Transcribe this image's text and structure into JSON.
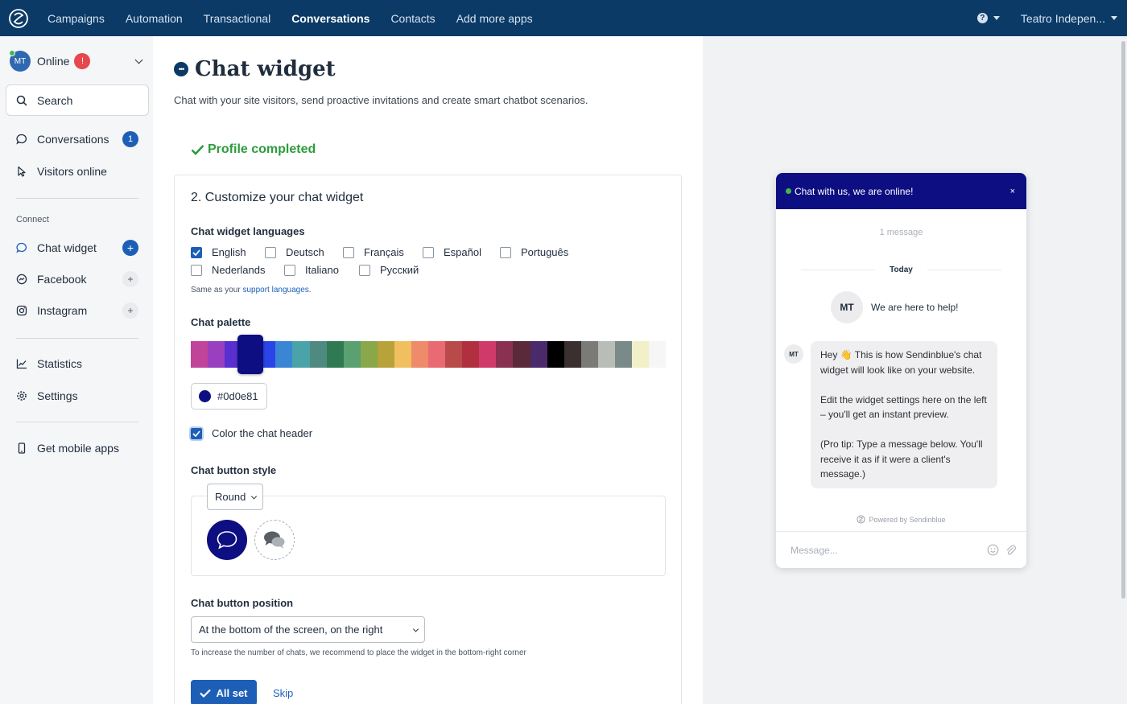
{
  "topnav": {
    "items": [
      "Campaigns",
      "Automation",
      "Transactional",
      "Conversations",
      "Contacts",
      "Add more apps"
    ],
    "active_index": 3,
    "account": "Teatro Indepen..."
  },
  "sidebar": {
    "avatar_initials": "MT",
    "status": "Online",
    "alert": "!",
    "search_label": "Search",
    "items": [
      {
        "label": "Conversations",
        "badge": "1"
      },
      {
        "label": "Visitors online"
      }
    ],
    "connect_heading": "Connect",
    "connect_items": [
      {
        "label": "Chat widget",
        "action": "+"
      },
      {
        "label": "Facebook",
        "action": "+"
      },
      {
        "label": "Instagram",
        "action": "+"
      }
    ],
    "bottom_items": [
      {
        "label": "Statistics"
      },
      {
        "label": "Settings"
      }
    ],
    "mobile_label": "Get mobile apps"
  },
  "main": {
    "title": "Chat widget",
    "subtitle": "Chat with your site visitors, send proactive invitations and create smart chatbot scenarios.",
    "profile_status": "Profile completed",
    "card_title": "2. Customize your chat widget",
    "languages_label": "Chat widget languages",
    "languages": [
      {
        "label": "English",
        "checked": true
      },
      {
        "label": "Deutsch",
        "checked": false
      },
      {
        "label": "Français",
        "checked": false
      },
      {
        "label": "Español",
        "checked": false
      },
      {
        "label": "Português",
        "checked": false
      },
      {
        "label": "Nederlands",
        "checked": false
      },
      {
        "label": "Italiano",
        "checked": false
      },
      {
        "label": "Русский",
        "checked": false
      }
    ],
    "languages_note_prefix": "Same as your ",
    "languages_note_link": "support languages",
    "languages_note_suffix": ".",
    "palette_label": "Chat palette",
    "palette": [
      "#c0449a",
      "#9a3fc0",
      "#5a2fd0",
      "#0d0e81",
      "#2a44e8",
      "#3a86d4",
      "#4aa3a8",
      "#4f8a80",
      "#2f7a52",
      "#5aa070",
      "#8aa84a",
      "#b8a23a",
      "#f0c060",
      "#ef8a6a",
      "#e86a72",
      "#b84a4a",
      "#b03040",
      "#d03a6a",
      "#8a3050",
      "#5a2a3a",
      "#4a2a6a",
      "#000000",
      "#3a3030",
      "#7a7a78",
      "#b8bdb8",
      "#7a8a88",
      "#f2f0c8",
      "#f6f6f6"
    ],
    "selected_color": "#0d0e81",
    "color_header_label": "Color the chat header",
    "color_header_checked": true,
    "button_style_label": "Chat button style",
    "button_style_value": "Round",
    "button_position_label": "Chat button position",
    "button_position_value": "At the bottom of the screen, on the right",
    "position_note": "To increase the number of chats, we recommend to place the widget in the bottom-right corner",
    "primary_button": "All set",
    "skip_link": "Skip"
  },
  "preview": {
    "header_text": "Chat with us, we are online!",
    "close": "×",
    "message_count": "1 message",
    "day_label": "Today",
    "agent_initials": "MT",
    "agent_greeting": "We are here to help!",
    "bubble": [
      "Hey 👋 This is how Sendinblue's chat widget will look like on your website.",
      "Edit the widget settings here on the left – you'll get an instant preview.",
      "(Pro tip: Type a message below. You'll receive it as if it were a client's message.)"
    ],
    "powered_by": "Powered by Sendinblue",
    "input_placeholder": "Message..."
  },
  "colors": {
    "nav_bg": "#0b3a66",
    "accent": "#1d5fb7",
    "success": "#2d9c3c",
    "widget_header": "#0d0e81"
  }
}
